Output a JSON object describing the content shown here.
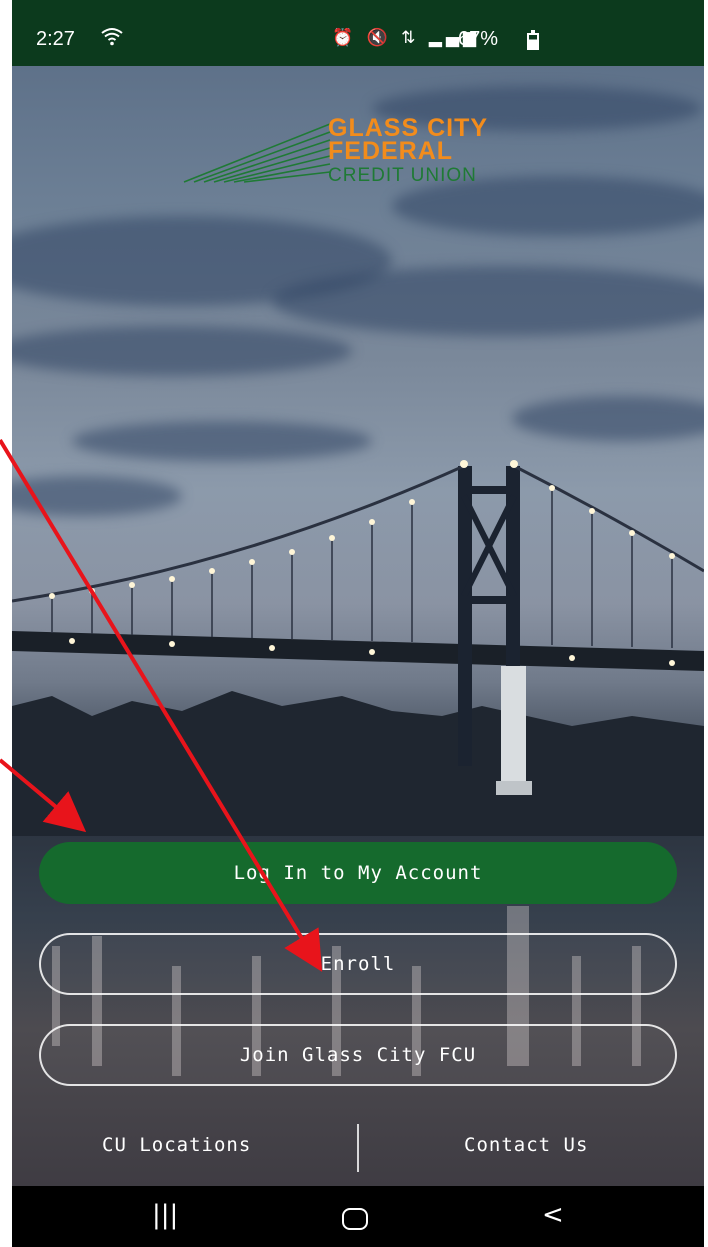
{
  "status_bar": {
    "time": "2:27",
    "wifi_icon": "wifi-icon",
    "icons_text": "⏰ 🔇 ⇅ ▂▄▆",
    "battery": "67%"
  },
  "logo": {
    "line1": "GLASS CITY",
    "line2": "FEDERAL",
    "line3": "CREDIT UNION",
    "orange": "#f28c1c",
    "green": "#1f7a35"
  },
  "buttons": {
    "login": "Log In to My Account",
    "enroll": "Enroll",
    "join": "Join Glass City FCU"
  },
  "footer": {
    "locations": "CU Locations",
    "contact": "Contact Us"
  },
  "nav_bar": {
    "recents": "|||",
    "back": "<"
  },
  "colors": {
    "status_bar": "#0c3a1d",
    "primary_button": "#156a2d",
    "annotation_arrow": "#e8141b"
  }
}
